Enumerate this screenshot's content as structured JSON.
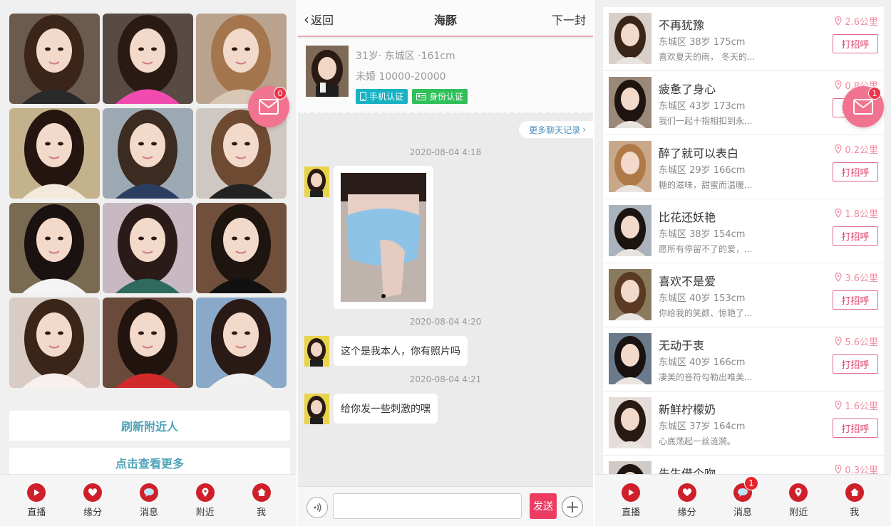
{
  "screen_grid": {
    "unread_count": "0",
    "refresh_label": "刷新附近人",
    "more_label": "点击查看更多",
    "photos": [
      {
        "bg": "#6b5a4e",
        "hair": "#3b2418",
        "shirt": "#2a2a2a"
      },
      {
        "bg": "#5a4a45",
        "hair": "#2a1a14",
        "shirt": "#f24bb0"
      },
      {
        "bg": "#b9a38f",
        "hair": "#a5764e",
        "shirt": "#d9c7b5"
      },
      {
        "bg": "#c4b28c",
        "hair": "#241510",
        "shirt": "#f3e9dc"
      },
      {
        "bg": "#9ca9b3",
        "hair": "#3b2b20",
        "shirt": "#2c3e60"
      },
      {
        "bg": "#cfc8c2",
        "hair": "#6e4a32",
        "shirt": "#222222"
      },
      {
        "bg": "#7a6a52",
        "hair": "#1a1210",
        "shirt": "#f4f4f4"
      },
      {
        "bg": "#c8b8c2",
        "hair": "#2a1a18",
        "shirt": "#2f6a5e"
      },
      {
        "bg": "#70503c",
        "hair": "#1e1510",
        "shirt": "#111111"
      },
      {
        "bg": "#d9ccc5",
        "hair": "#3a2518",
        "shirt": "#f7f0ee"
      },
      {
        "bg": "#6a4a3a",
        "hair": "#21140f",
        "shirt": "#d22a2a"
      },
      {
        "bg": "#8aa8c8",
        "hair": "#2a1a15",
        "shirt": "#f1f1f1"
      }
    ]
  },
  "chat": {
    "back_label": "返回",
    "title": "海豚",
    "next_label": "下一封",
    "profile": {
      "line1": "31岁· 东城区 ·161cm",
      "line2": "未婚 10000-20000",
      "tag_phone": "手机认证",
      "tag_id": "身份认证"
    },
    "more_history": "更多聊天记录",
    "ts1": "2020-08-04 4:18",
    "ts2": "2020-08-04 4:20",
    "msg2": "这个是我本人，你有照片吗",
    "ts3": "2020-08-04 4:21",
    "msg3": "给你发一些刺激的嘿",
    "input_value": "",
    "send_label": "发送"
  },
  "nearby": {
    "unread_count": "1",
    "greet_label": "打招呼",
    "rows": [
      {
        "name": "不再犹豫",
        "info": "东城区 38岁 175cm",
        "sig": "喜欢夏天的雨， 冬天的...",
        "dist": "2.6公里",
        "hair": "#3b2418",
        "bg": "#d8cfc9"
      },
      {
        "name": "疲惫了身心",
        "info": "东城区 43岁 173cm",
        "sig": "我们一起十指相扣到永...",
        "dist": "0.8公里",
        "hair": "#1e1410",
        "bg": "#9a8878"
      },
      {
        "name": "醉了就可以表白",
        "info": "东城区 29岁 166cm",
        "sig": "糖的滋味，甜蜜而温暖...",
        "dist": "0.2公里",
        "hair": "#b07a48",
        "bg": "#c9a88a"
      },
      {
        "name": "比花还妖艳",
        "info": "东城区 38岁 154cm",
        "sig": "愿所有停留不了的爱，...",
        "dist": "1.8公里",
        "hair": "#1c1410",
        "bg": "#aab3bd"
      },
      {
        "name": "喜欢不是爱",
        "info": "东城区 40岁 153cm",
        "sig": "你给我的笑颜、惊艳了...",
        "dist": "3.6公里",
        "hair": "#5a3a24",
        "bg": "#8a7a5e"
      },
      {
        "name": "无动于衷",
        "info": "东城区 40岁 166cm",
        "sig": "凄美的音符勾勒出唯美...",
        "dist": "5.6公里",
        "hair": "#1a1210",
        "bg": "#6a7a8a"
      },
      {
        "name": "新鲜柠檬奶",
        "info": "东城区 37岁 164cm",
        "sig": "心底荡起一丝涟漪。",
        "dist": "1.6公里",
        "hair": "#2a1a14",
        "bg": "#e4dcd8"
      },
      {
        "name": "先生借个吻",
        "info": "",
        "sig": "",
        "dist": "0.3公里",
        "hair": "#1e1410",
        "bg": "#cfcac6"
      }
    ]
  },
  "tabs_left": [
    {
      "label": "直播",
      "icon": "play-icon"
    },
    {
      "label": "缘分",
      "icon": "heart-icon"
    },
    {
      "label": "消息",
      "icon": "chat-icon"
    },
    {
      "label": "附近",
      "icon": "location-icon"
    },
    {
      "label": "我",
      "icon": "home-icon"
    }
  ],
  "tabs_right": [
    {
      "label": "直播",
      "icon": "play-icon"
    },
    {
      "label": "缘分",
      "icon": "heart-icon"
    },
    {
      "label": "消息",
      "icon": "chat-icon",
      "badge": "1"
    },
    {
      "label": "附近",
      "icon": "location-icon"
    },
    {
      "label": "我",
      "icon": "home-icon"
    }
  ],
  "colors": {
    "accent_pink": "#f27390",
    "tab_red": "#cf1f2a",
    "send_pink": "#ed3c62",
    "link_teal": "#4fa3b8"
  }
}
